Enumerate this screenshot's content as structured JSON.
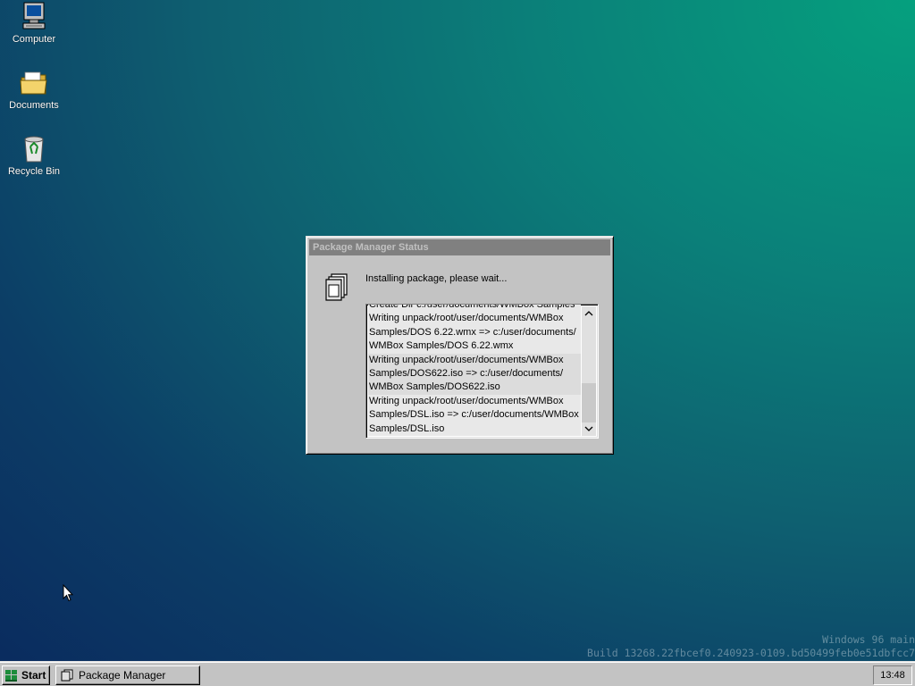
{
  "desktop": {
    "icons": [
      {
        "label": "Computer",
        "icon": "computer-icon"
      },
      {
        "label": "Documents",
        "icon": "folder-icon"
      },
      {
        "label": "Recycle Bin",
        "icon": "recycle-bin-icon"
      }
    ]
  },
  "dialog": {
    "title": "Package Manager Status",
    "icon": "package-icon",
    "status": "Installing package, please wait...",
    "log_lines": [
      "Create Dir c:/user/documents/WMBox Samples",
      "Writing unpack/root/user/documents/WMBox",
      "Samples/DOS 6.22.wmx => c:/user/documents/",
      "WMBox Samples/DOS 6.22.wmx",
      "Writing unpack/root/user/documents/WMBox",
      "Samples/DOS622.iso => c:/user/documents/",
      "WMBox Samples/DOS622.iso",
      "Writing unpack/root/user/documents/WMBox",
      "Samples/DSL.iso => c:/user/documents/WMBox",
      "Samples/DSL.iso"
    ],
    "scroll_up_glyph": "⌃",
    "scroll_down_glyph": "⌄"
  },
  "build_info": {
    "line1": "Windows 96 main",
    "line2": "Build 13268.22fbcef0.240923-0109.bd50499feb0e51dbfcc7"
  },
  "taskbar": {
    "start_label": "Start",
    "tasks": [
      {
        "label": "Package Manager",
        "icon": "package-icon"
      }
    ],
    "clock": "13:48"
  },
  "colors": {
    "desktop_top": "#05a07e",
    "desktop_bottom": "#0a2a5e",
    "chrome": "#c3c3c3",
    "titlebar_inactive": "#808080"
  }
}
